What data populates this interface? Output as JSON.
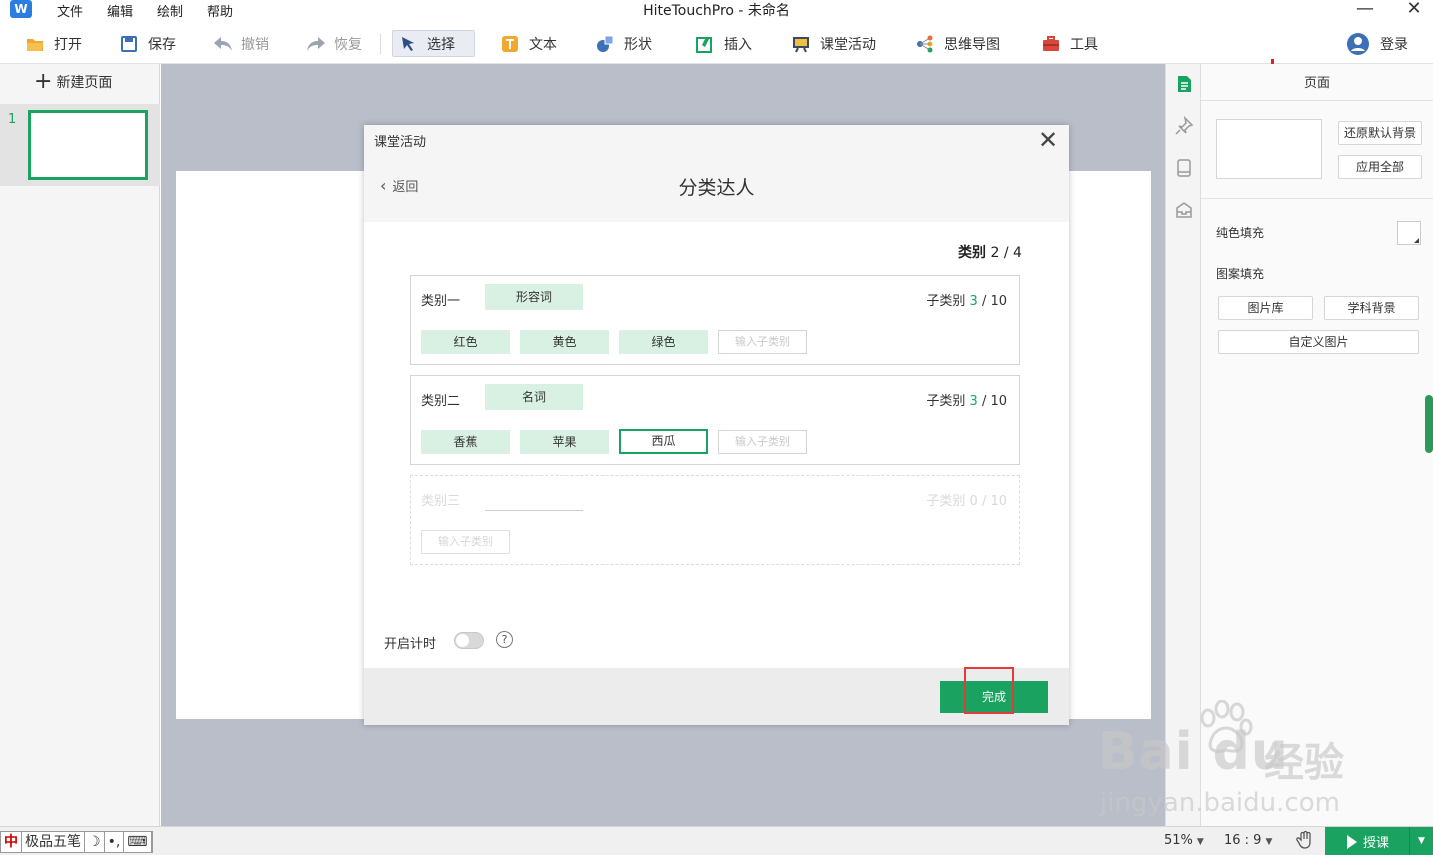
{
  "app": {
    "logo_glyph": "W",
    "title": "HiteTouchPro - 未命名",
    "menu": [
      "文件",
      "编辑",
      "绘制",
      "帮助"
    ],
    "window_controls": {
      "minimize": "—",
      "close": "✕"
    }
  },
  "toolbar": {
    "open": "打开",
    "save": "保存",
    "undo": "撤销",
    "redo": "恢复",
    "select": "选择",
    "text": "文本",
    "shape": "形状",
    "insert": "插入",
    "classroom": "课堂活动",
    "mindmap": "思维导图",
    "tools": "工具",
    "login": "登录"
  },
  "pages": {
    "new_page": "新建页面",
    "items": [
      {
        "number": "1"
      }
    ]
  },
  "right_panel": {
    "title": "页面",
    "restore_bg": "还原默认背景",
    "apply_all": "应用全部",
    "solid_fill": "纯色填充",
    "pattern_fill": "图案填充",
    "gallery": "图片库",
    "subject_bg": "学科背景",
    "custom_image": "自定义图片"
  },
  "statusbar": {
    "ime": [
      "中",
      "极品五笔",
      "☽",
      "•,",
      "⌨"
    ],
    "zoom": "51%",
    "ratio": "16 : 9",
    "present": "授课"
  },
  "dialog": {
    "title": "课堂活动",
    "back": "返回",
    "heading": "分类达人",
    "category_count": {
      "label": "类别",
      "current": "2",
      "total": "/ 4"
    },
    "categories": [
      {
        "label": "类别一",
        "name": "形容词",
        "sub_label": "子类别",
        "sub_current": "3",
        "sub_total": "/ 10",
        "items": [
          "红色",
          "黄色",
          "绿色"
        ],
        "input_placeholder": "输入子类别"
      },
      {
        "label": "类别二",
        "name": "名词",
        "sub_label": "子类别",
        "sub_current": "3",
        "sub_total": "/ 10",
        "items": [
          "香蕉",
          "苹果"
        ],
        "editing": "西瓜",
        "input_placeholder": "输入子类别"
      },
      {
        "label": "类别三",
        "name": "",
        "sub_label": "子类别",
        "sub_current": "0",
        "sub_total": "/ 10",
        "items": [],
        "input_placeholder": "输入子类别"
      }
    ],
    "timer_label": "开启计时",
    "timer_on": false,
    "help": "?",
    "done": "完成"
  },
  "watermark": {
    "brand": "Bai du",
    "cn": "经验",
    "url": "jingyan.baidu.com"
  },
  "colors": {
    "accent": "#1aa260",
    "chip_bg": "#d8f1e3",
    "canvas_bg": "#b9bec9",
    "highlight": "#e23b3b"
  }
}
